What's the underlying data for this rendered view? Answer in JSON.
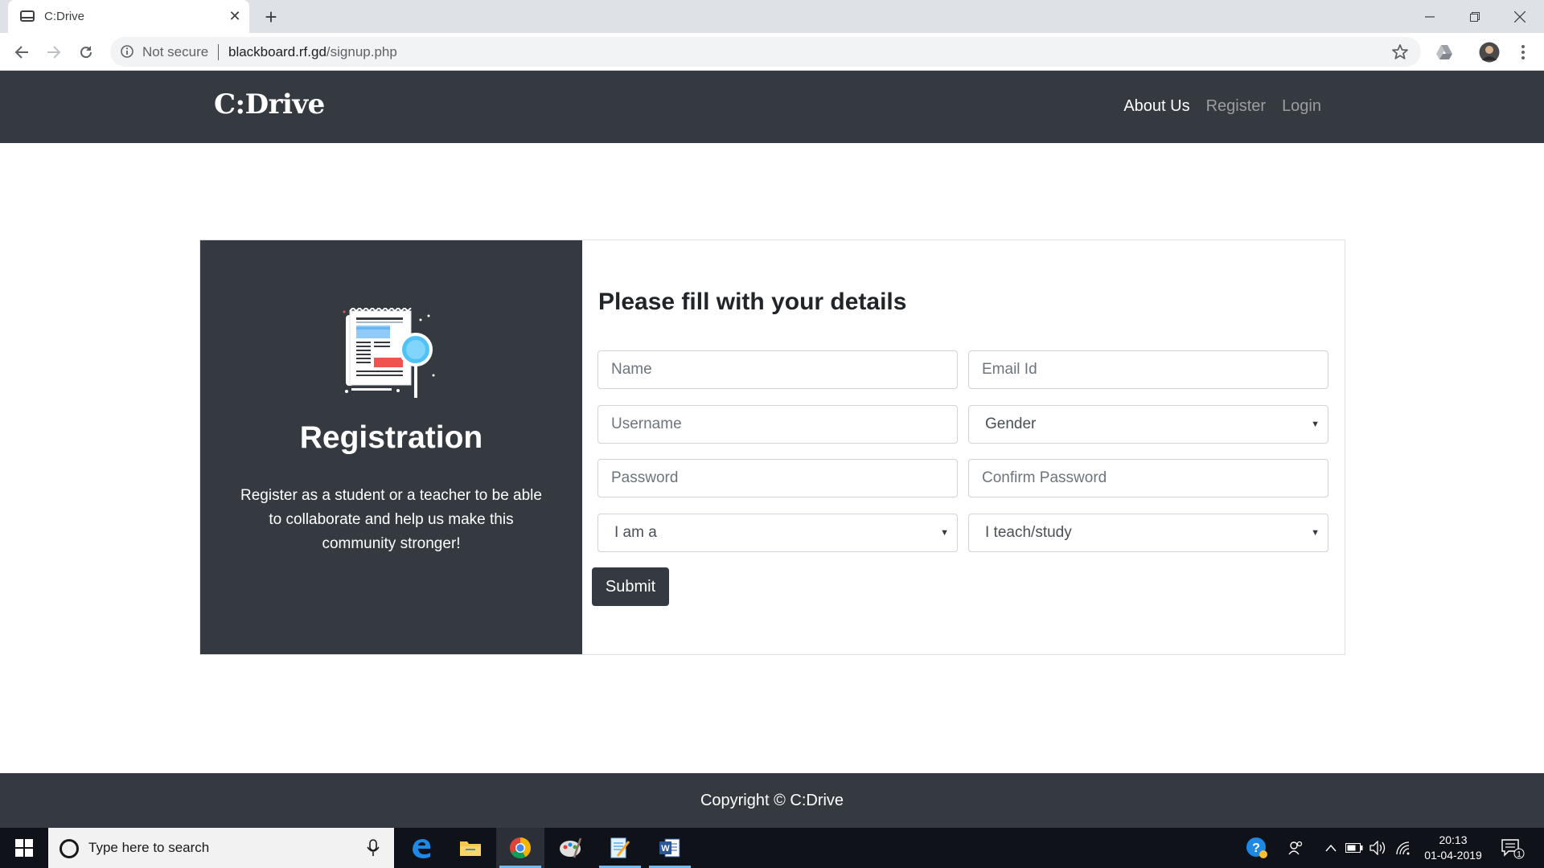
{
  "browser": {
    "tab_title": "C:Drive",
    "new_tab_symbol": "+",
    "security_label": "Not secure",
    "url_host": "blackboard.rf.gd",
    "url_path": "/signup.php"
  },
  "site": {
    "brand": "C:Drive",
    "nav": {
      "about": "About Us",
      "register": "Register",
      "login": "Login"
    }
  },
  "registration": {
    "heading": "Registration",
    "description": "Register as a student or a teacher to be able to collaborate and help us make this community stronger!",
    "form_title": "Please fill with your details",
    "fields": {
      "name_placeholder": "Name",
      "email_placeholder": "Email Id",
      "username_placeholder": "Username",
      "gender_selected": "Gender",
      "password_placeholder": "Password",
      "confirm_password_placeholder": "Confirm Password",
      "role_selected": "I am a",
      "subject_selected": "I teach/study"
    },
    "submit_label": "Submit"
  },
  "footer": {
    "copyright": "Copyright © C:Drive"
  },
  "taskbar": {
    "search_placeholder": "Type here to search",
    "time": "20:13",
    "date": "01-04-2019",
    "notification_count": "1"
  },
  "colors": {
    "dark": "#343a40",
    "taskbar": "#10121a",
    "accent_blue": "#76b9ed"
  }
}
